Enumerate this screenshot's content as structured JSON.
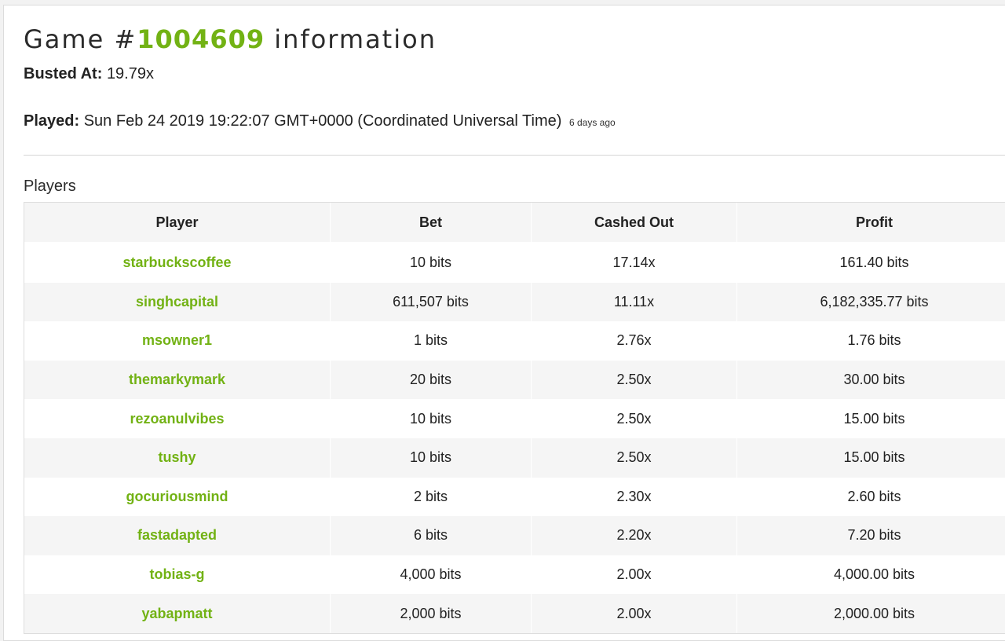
{
  "game": {
    "title_prefix": "Game #",
    "id": "1004609",
    "title_suffix": " information",
    "busted_label": "Busted At:",
    "busted_value": "19.79x",
    "played_label": "Played:",
    "played_value": "Sun Feb 24 2019 19:22:07 GMT+0000 (Coordinated Universal Time)",
    "played_ago": "6 days ago"
  },
  "players": {
    "heading": "Players",
    "columns": [
      "Player",
      "Bet",
      "Cashed Out",
      "Profit"
    ],
    "rows": [
      {
        "player": "starbuckscoffee",
        "bet": "10 bits",
        "cashed_out": "17.14x",
        "profit": "161.40 bits"
      },
      {
        "player": "singhcapital",
        "bet": "611,507 bits",
        "cashed_out": "11.11x",
        "profit": "6,182,335.77 bits"
      },
      {
        "player": "msowner1",
        "bet": "1 bits",
        "cashed_out": "2.76x",
        "profit": "1.76 bits"
      },
      {
        "player": "themarkymark",
        "bet": "20 bits",
        "cashed_out": "2.50x",
        "profit": "30.00 bits"
      },
      {
        "player": "rezoanulvibes",
        "bet": "10 bits",
        "cashed_out": "2.50x",
        "profit": "15.00 bits"
      },
      {
        "player": "tushy",
        "bet": "10 bits",
        "cashed_out": "2.50x",
        "profit": "15.00 bits"
      },
      {
        "player": "gocuriousmind",
        "bet": "2 bits",
        "cashed_out": "2.30x",
        "profit": "2.60 bits"
      },
      {
        "player": "fastadapted",
        "bet": "6 bits",
        "cashed_out": "2.20x",
        "profit": "7.20 bits"
      },
      {
        "player": "tobias-g",
        "bet": "4,000 bits",
        "cashed_out": "2.00x",
        "profit": "4,000.00 bits"
      },
      {
        "player": "yabapmatt",
        "bet": "2,000 bits",
        "cashed_out": "2.00x",
        "profit": "2,000.00 bits"
      }
    ]
  },
  "colors": {
    "accent_green": "#72b214",
    "row_stripe": "#f5f5f5"
  }
}
